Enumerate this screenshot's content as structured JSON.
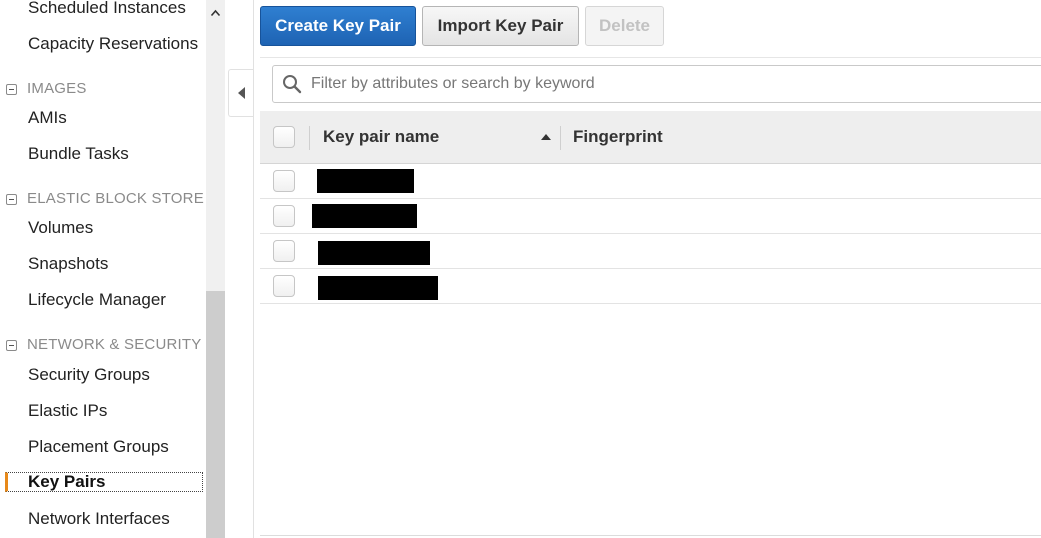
{
  "sidebar": {
    "items_top": [
      "Scheduled Instances",
      "Capacity Reservations"
    ],
    "sections": [
      {
        "label": "IMAGES",
        "items": [
          "AMIs",
          "Bundle Tasks"
        ]
      },
      {
        "label": "ELASTIC BLOCK STORE",
        "items": [
          "Volumes",
          "Snapshots",
          "Lifecycle Manager"
        ]
      },
      {
        "label": "NETWORK & SECURITY",
        "items": [
          "Security Groups",
          "Elastic IPs",
          "Placement Groups",
          "Key Pairs",
          "Network Interfaces"
        ]
      }
    ],
    "active_item": "Key Pairs"
  },
  "toolbar": {
    "create_label": "Create Key Pair",
    "import_label": "Import Key Pair",
    "delete_label": "Delete"
  },
  "filter": {
    "placeholder": "Filter by attributes or search by keyword"
  },
  "table": {
    "columns": [
      "Key pair name",
      "Fingerprint"
    ],
    "sort": {
      "column": "Key pair name",
      "direction": "ascending"
    },
    "rows": [
      {
        "key_pair_name": "[redacted]",
        "fingerprint": ""
      },
      {
        "key_pair_name": "[redacted]",
        "fingerprint": ""
      },
      {
        "key_pair_name": "[redacted]",
        "fingerprint": ""
      },
      {
        "key_pair_name": "[redacted]",
        "fingerprint": ""
      }
    ]
  },
  "colors": {
    "primary_button": "#1e63b3",
    "active_nav_accent": "#e7891a",
    "redaction": "#000000"
  }
}
